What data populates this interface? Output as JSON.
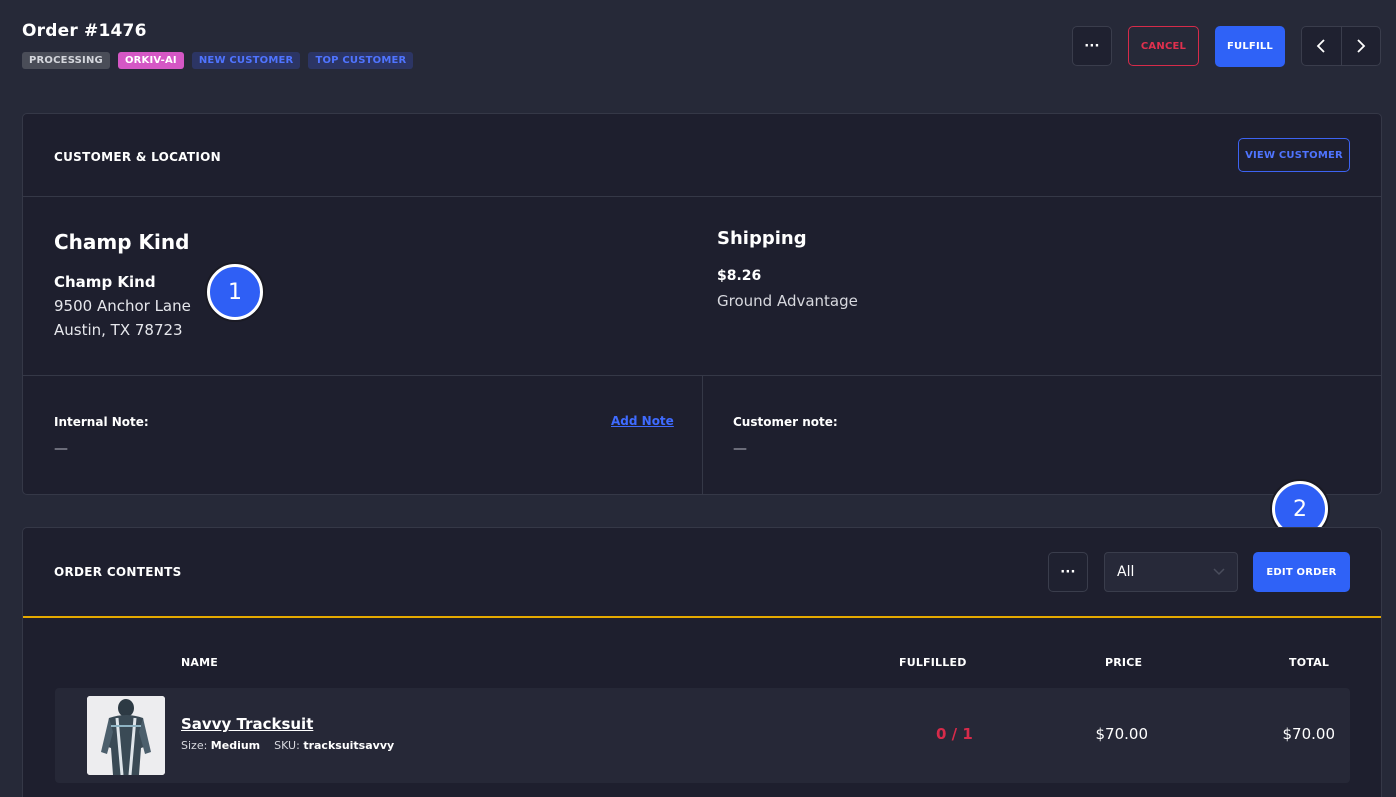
{
  "header": {
    "title": "Order #1476",
    "tags": [
      "PROCESSING",
      "ORKIV-AI",
      "NEW CUSTOMER",
      "TOP CUSTOMER"
    ],
    "more_label": "···",
    "cancel_label": "CANCEL",
    "fulfill_label": "FULFILL",
    "prev_label": "‹",
    "next_label": "›"
  },
  "customer": {
    "section_title": "CUSTOMER & LOCATION",
    "view_button": "VIEW CUSTOMER",
    "name": "Champ Kind",
    "address_name": "Champ Kind",
    "address_line1": "9500 Anchor Lane",
    "address_line2": "Austin, TX 78723",
    "shipping_title": "Shipping",
    "shipping_price": "$8.26",
    "shipping_method": "Ground Advantage",
    "internal_note_label": "Internal Note:",
    "internal_note_value": "—",
    "add_note_label": "Add Note",
    "customer_note_label": "Customer note:",
    "customer_note_value": "—"
  },
  "badges": [
    "1",
    "2"
  ],
  "contents": {
    "section_title": "ORDER CONTENTS",
    "more_label": "···",
    "filter_value": "All",
    "edit_button": "EDIT ORDER",
    "columns": [
      "NAME",
      "FULFILLED",
      "PRICE",
      "TOTAL"
    ],
    "items": [
      {
        "name": "Savvy Tracksuit",
        "size_label": "Size:",
        "size_value": "Medium",
        "sku_label": "SKU:",
        "sku_value": "tracksuitsavvy",
        "fulfilled": "0 / 1",
        "price": "$70.00",
        "total": "$70.00"
      }
    ]
  },
  "colors": {
    "background": "#262938",
    "card": "#1e1f2e",
    "primary": "#2f62f7",
    "danger": "#d62b4a",
    "accent_line": "#e5a900",
    "tag_orkiv": "#d557c5"
  }
}
